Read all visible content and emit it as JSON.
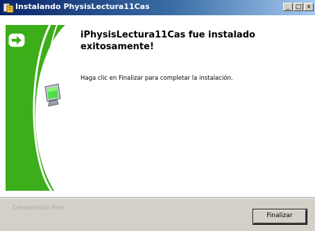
{
  "window": {
    "title": "Instalando PhysisLectura11Cas",
    "minimize_glyph": "_",
    "maximize_glyph": "□",
    "close_glyph": "x"
  },
  "content": {
    "heading": "iPhysisLectura11Cas fue instalado exitosamente!",
    "message": "Haga clic en Finalizar para completar la instalación."
  },
  "footer": {
    "brand": "CreateInstall Free",
    "finish_label": "Finalizar"
  },
  "colors": {
    "banner_green": "#3cae1a",
    "title_bar": "#0a246a"
  },
  "icons": [
    "installer-app-icon",
    "arrow-right-icon",
    "computer-monitor-icon"
  ]
}
